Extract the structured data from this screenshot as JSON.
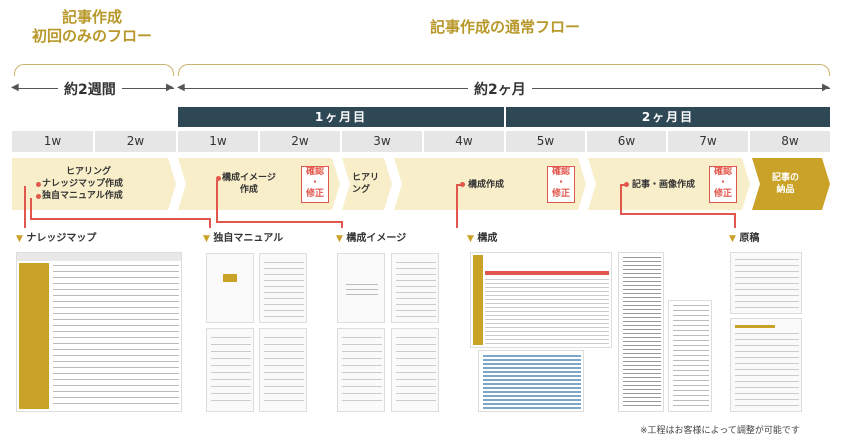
{
  "header": {
    "first_flow_line1": "記事作成",
    "first_flow_line2": "初回のみのフロー",
    "normal_flow": "記事作成の通常フロー"
  },
  "spans": {
    "short": "約2週間",
    "long": "約2ヶ月"
  },
  "months": [
    "1ヶ月目",
    "2ヶ月目"
  ],
  "weeks": [
    "1w",
    "2w",
    "1w",
    "2w",
    "3w",
    "4w",
    "5w",
    "6w",
    "7w",
    "8w"
  ],
  "phases": {
    "hearing_line1": "ヒアリング",
    "hearing_line2": "ナレッジマップ作成",
    "hearing_line3": "独自マニュアル作成",
    "image_line1": "構成イメージ",
    "image_line2": "作成",
    "hearing2_line1": "ヒアリ",
    "hearing2_line2": "ング",
    "structure": "構成作成",
    "writing": "記事・画像作成",
    "delivery_line1": "記事の",
    "delivery_line2": "納品",
    "check_line1": "確認",
    "check_line2": "・",
    "check_line3": "修正"
  },
  "sections": {
    "knowledge_map": "ナレッジマップ",
    "manual": "独自マニュアル",
    "image": "構成イメージ",
    "structure": "構成",
    "draft": "原稿"
  },
  "note": "※工程はお客様によって調整が可能です",
  "colors": {
    "gold": "#b8982a",
    "navy": "#2f4856",
    "phase": "#f8eec9",
    "accent_red": "#e2574c"
  }
}
